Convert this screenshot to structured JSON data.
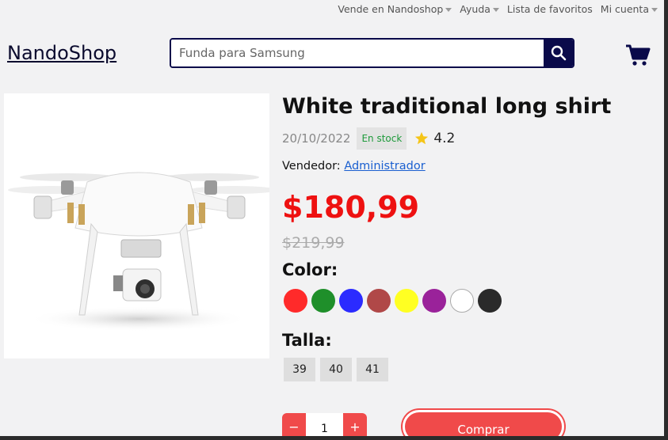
{
  "topnav": {
    "sell": "Vende en Nandoshop",
    "help": "Ayuda",
    "favorites": "Lista de favoritos",
    "account": "Mi cuenta"
  },
  "header": {
    "logo": "NandoShop",
    "search_placeholder": "Funda para Samsung"
  },
  "product": {
    "title": "White traditional long shirt",
    "date": "20/10/2022",
    "stock": "En stock",
    "rating": "4.2",
    "seller_label": "Vendedor:",
    "seller_name": "Administrador",
    "price": "$180,99",
    "old_price": "$219,99",
    "color_label": "Color:",
    "colors": [
      "#ff2a2a",
      "#1f8f2a",
      "#2b2bff",
      "#b04848",
      "#ffff22",
      "#9a229a",
      "#ffffff",
      "#2a2a2a"
    ],
    "size_label": "Talla:",
    "sizes": [
      "39",
      "40",
      "41"
    ],
    "quantity": "1",
    "minus": "−",
    "plus": "+",
    "buy_label": "Comprar"
  },
  "colors": {
    "accent": "#f04a4a",
    "brand": "#0a0a4a",
    "price": "#ee1111"
  }
}
